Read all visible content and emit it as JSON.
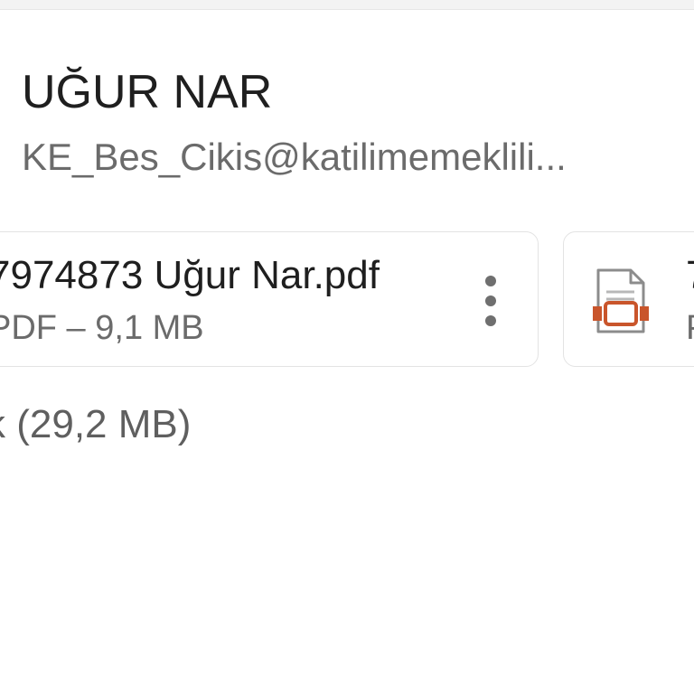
{
  "email": {
    "sender_name": "UĞUR NAR",
    "sender_address": "KE_Bes_Cikis@katilimemeklili..."
  },
  "attachments": [
    {
      "name": "7974873 Uğur Nar.pdf",
      "meta": "PDF – 9,1 MB",
      "menu_icon": "more-vert-icon"
    },
    {
      "name": "7",
      "meta": "P",
      "icon": "presentation-file-icon"
    }
  ],
  "summary": {
    "total_size": "k (29,2 MB)"
  },
  "colors": {
    "file_icon_accent": "#c9552b",
    "text_primary": "#1f1f1f",
    "text_secondary": "#6b6b6b"
  }
}
